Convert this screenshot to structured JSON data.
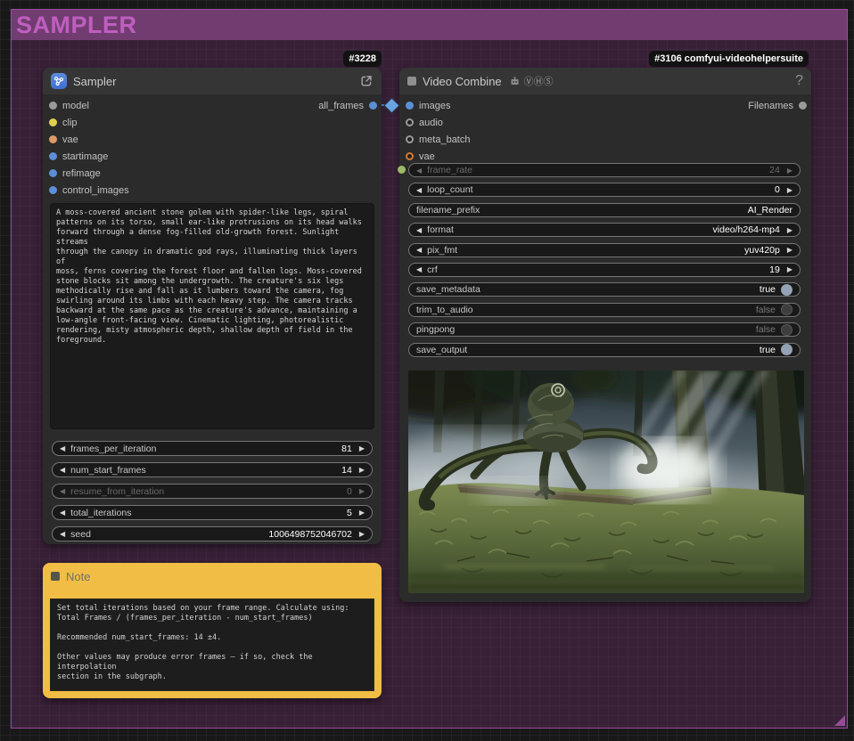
{
  "group": {
    "title": "SAMPLER"
  },
  "colors": {
    "group_header_purple": "#713d70",
    "group_border_purple": "#9c4c9a",
    "link_blue": "#5a8fd8",
    "note_orange": "#f2bd45",
    "toggle_on_gray_blue": "#93a3b5"
  },
  "sampler": {
    "badge": "#3228",
    "title": "Sampler",
    "inputs": [
      {
        "label": "model",
        "dot": "background:#9a9a9a"
      },
      {
        "label": "clip",
        "dot": "background:#e3cf4e"
      },
      {
        "label": "vae",
        "dot": "background:#dd9b66"
      },
      {
        "label": "startimage",
        "dot": "background:#5a8fd8"
      },
      {
        "label": "refimage",
        "dot": "background:#5a8fd8"
      },
      {
        "label": "control_images",
        "dot": "background:#5a8fd8"
      }
    ],
    "output": {
      "label": "all_frames",
      "dot": "background:#5a8fd8"
    },
    "prompt": "A moss-covered ancient stone golem with spider-like legs, spiral\npatterns on its torso, small ear-like protrusions on its head walks\nforward through a dense fog-filled old-growth forest. Sunlight streams\nthrough the canopy in dramatic god rays, illuminating thick layers of\nmoss, ferns covering the forest floor and fallen logs. Moss-covered\nstone blocks sit among the undergrowth. The creature's six legs\nmethodically rise and fall as it lumbers toward the camera, fog\nswirling around its limbs with each heavy step. The camera tracks\nbackward at the same pace as the creature's advance, maintaining a\nlow-angle front-facing view. Cinematic lighting, photorealistic\nrendering, misty atmospheric depth, shallow depth of field in the\nforeground.",
    "widgets": [
      {
        "label": "frames_per_iteration",
        "value": "81"
      },
      {
        "label": "num_start_frames",
        "value": "14"
      },
      {
        "label": "resume_from_iteration",
        "value": "0"
      },
      {
        "label": "total_iterations",
        "value": "5"
      },
      {
        "label": "seed",
        "value": "1006498752046702"
      }
    ]
  },
  "video_combine": {
    "badge": "#3106 comfyui-videohelpersuite",
    "title": "Video Combine",
    "suite_letters": "ⓋⒽⓈ",
    "help": "?",
    "inputs": [
      {
        "label": "images",
        "dot": "background:#5a8fd8"
      },
      {
        "label": "audio",
        "dot": "border-color:#9a9a9a"
      },
      {
        "label": "meta_batch",
        "dot": "border-color:#9a9a9a"
      },
      {
        "label": "vae",
        "dot": "border-color:#d5792f"
      }
    ],
    "output": {
      "label": "Filenames",
      "dot": "background:#9a9a9a"
    },
    "frame_rate_input_dot": "background:#9cba63",
    "widgets": [
      {
        "label": "frame_rate",
        "value": "24"
      },
      {
        "label": "loop_count",
        "value": "0"
      },
      {
        "label": "filename_prefix",
        "value": "AI_Render"
      },
      {
        "label": "format",
        "value": "video/h264-mp4"
      },
      {
        "label": "pix_fmt",
        "value": "yuv420p"
      },
      {
        "label": "crf",
        "value": "19"
      },
      {
        "label": "save_metadata",
        "value": "true"
      },
      {
        "label": "trim_to_audio",
        "value": "false"
      },
      {
        "label": "pingpong",
        "value": "false"
      },
      {
        "label": "save_output",
        "value": "true"
      }
    ]
  },
  "note": {
    "title": "Note",
    "text": "Set total iterations based on your frame range. Calculate using:\nTotal Frames / (frames_per_iteration - num_start_frames)\n\nRecommended num_start_frames: 14 ±4.\n\nOther values may produce error frames — if so, check the interpolation\nsection in the subgraph."
  }
}
